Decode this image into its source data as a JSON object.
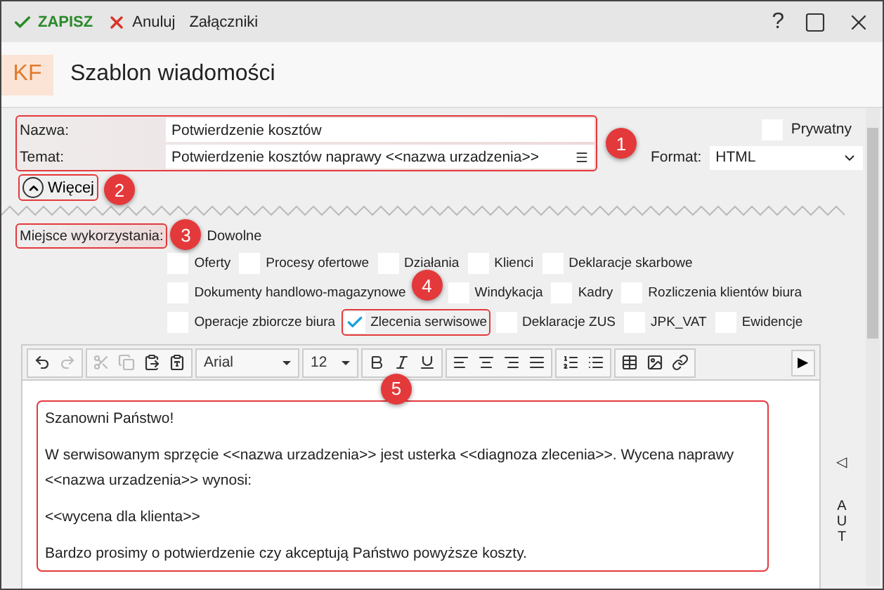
{
  "toolbar": {
    "actions": [
      {
        "kind": "save",
        "label": "ZAPISZ"
      },
      {
        "kind": "cancel",
        "label": "Anuluj"
      },
      {
        "kind": "plain",
        "label": "Załączniki"
      }
    ],
    "help": "?"
  },
  "header": {
    "badge": "KF",
    "title": "Szablon wiadomości"
  },
  "form": {
    "highlighted": true,
    "callout": "1",
    "fields": [
      {
        "label": "Nazwa:",
        "value": "Potwierdzenie kosztów",
        "has_menu": false
      },
      {
        "label": "Temat:",
        "value": "Potwierdzenie kosztów naprawy <<nazwa urzadzenia>>",
        "has_menu": true
      }
    ],
    "private": {
      "label": "Prywatny",
      "checked": false
    },
    "format": {
      "label": "Format:",
      "value": "HTML"
    },
    "more": {
      "label": "Więcej",
      "highlighted": true,
      "callout": "2"
    }
  },
  "usage": {
    "label": "Miejsce wykorzystania:",
    "highlighted": true,
    "callout": "3",
    "any_option": "Dowolne",
    "options": [
      {
        "label": "Oferty",
        "checked": false,
        "highlighted": false
      },
      {
        "label": "Procesy ofertowe",
        "checked": false,
        "highlighted": false
      },
      {
        "label": "Działania",
        "checked": false,
        "highlighted": false
      },
      {
        "label": "Klienci",
        "checked": false,
        "highlighted": false
      },
      {
        "label": "Deklaracje skarbowe",
        "checked": false,
        "highlighted": false
      },
      {
        "label": "Dokumenty handlowo-magazynowe",
        "checked": false,
        "highlighted": false
      },
      {
        "label": "Windykacja",
        "checked": false,
        "highlighted": false,
        "callout": "4"
      },
      {
        "label": "Kadry",
        "checked": false,
        "highlighted": false
      },
      {
        "label": "Rozliczenia klientów biura",
        "checked": false,
        "highlighted": false
      },
      {
        "label": "Operacje zbiorcze biura",
        "checked": false,
        "highlighted": false
      },
      {
        "label": "Zlecenia serwisowe",
        "checked": true,
        "highlighted": true
      },
      {
        "label": "Deklaracje ZUS",
        "checked": false,
        "highlighted": false
      },
      {
        "label": "JPK_VAT",
        "checked": false,
        "highlighted": false
      },
      {
        "label": "Ewidencje",
        "checked": false,
        "highlighted": false
      }
    ]
  },
  "editor": {
    "groups": [
      {
        "tools": [
          {
            "kind": "undo",
            "disabled": false
          },
          {
            "kind": "redo",
            "disabled": true
          }
        ]
      },
      {
        "tools": [
          {
            "kind": "cut",
            "disabled": true
          },
          {
            "kind": "copy",
            "disabled": true
          },
          {
            "kind": "paste",
            "disabled": false
          },
          {
            "kind": "paste-text",
            "disabled": false
          }
        ]
      },
      {
        "select": "Arial"
      },
      {
        "select": "12"
      },
      {
        "callout": "5",
        "tools": [
          {
            "kind": "bold",
            "disabled": false
          },
          {
            "kind": "italic",
            "disabled": false
          },
          {
            "kind": "underline",
            "disabled": false
          }
        ]
      },
      {
        "tools": [
          {
            "kind": "align-left",
            "disabled": false
          },
          {
            "kind": "align-center",
            "disabled": false
          },
          {
            "kind": "align-right",
            "disabled": false
          },
          {
            "kind": "justify",
            "disabled": false
          }
        ]
      },
      {
        "tools": [
          {
            "kind": "ordered-list",
            "disabled": false
          },
          {
            "kind": "bullet-list",
            "disabled": false
          }
        ]
      },
      {
        "tools": [
          {
            "kind": "table",
            "disabled": false
          },
          {
            "kind": "image",
            "disabled": false
          },
          {
            "kind": "link",
            "disabled": false
          }
        ]
      }
    ],
    "more": "▶",
    "body": {
      "highlighted": true,
      "paragraphs": [
        "Szanowni Państwo!",
        "W serwisowanym sprzęcie <<nazwa urzadzenia>> jest usterka <<diagnoza zlecenia>>. Wycena naprawy <<nazwa urzadzenia>> wynosi:",
        "<<wycena dla klienta>>",
        "Bardzo prosimy o potwierdzenie czy akceptują Państwo powyższe koszty."
      ]
    }
  },
  "side_tab": {
    "arrow": "◁",
    "label": "AUT"
  }
}
